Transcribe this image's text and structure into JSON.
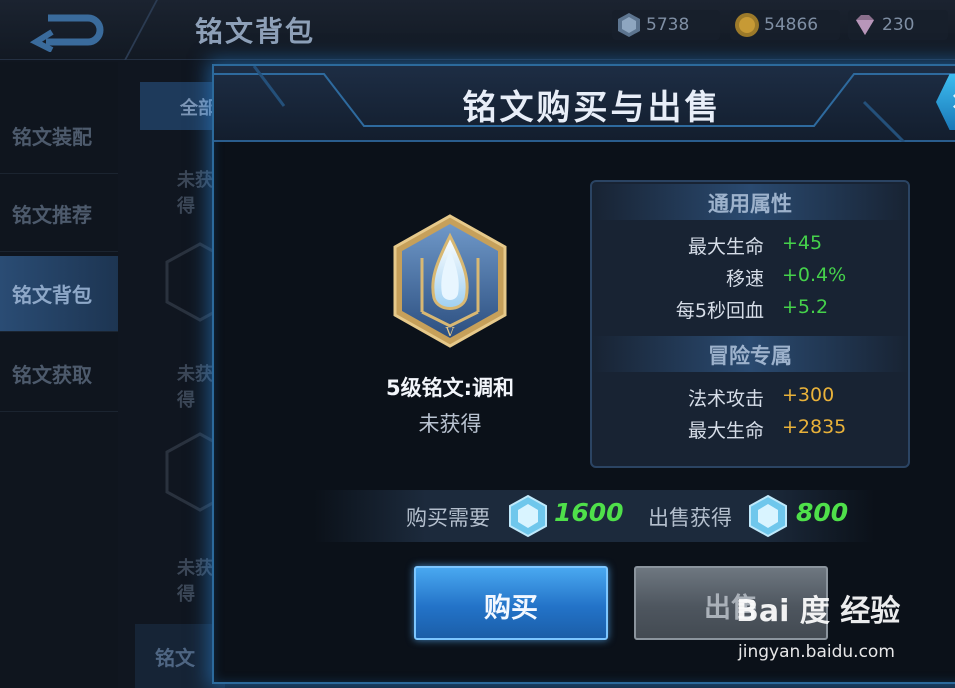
{
  "topbar": {
    "title": "铭文背包",
    "currencies": [
      {
        "name": "crystal",
        "amount": "5738"
      },
      {
        "name": "gold",
        "amount": "54866"
      },
      {
        "name": "diamond",
        "amount": "230"
      }
    ]
  },
  "sidebar": {
    "items": [
      {
        "label": "铭文装配"
      },
      {
        "label": "铭文推荐"
      },
      {
        "label": "铭文背包"
      },
      {
        "label": "铭文获取"
      }
    ],
    "active": "铭文背包"
  },
  "background_list": {
    "tab_label": "全部",
    "cells": [
      "未获得",
      "未获得",
      "未获得"
    ],
    "footer_label": "铭文"
  },
  "dialog": {
    "title": "铭文购买与出售",
    "rune": {
      "name": "5级铭文:调和",
      "status": "未获得",
      "icon": "teardrop-hexagon-rune-icon"
    },
    "general_stats": {
      "heading": "通用属性",
      "rows": [
        {
          "label": "最大生命",
          "value": "+45"
        },
        {
          "label": "移速",
          "value": "+0.4%"
        },
        {
          "label": "每5秒回血",
          "value": "+5.2"
        }
      ]
    },
    "adventure_stats": {
      "heading": "冒险专属",
      "rows": [
        {
          "label": "法术攻击",
          "value": "+300"
        },
        {
          "label": "最大生命",
          "value": "+2835"
        }
      ]
    },
    "buy_price": {
      "label": "购买需要",
      "amount": "1600"
    },
    "sell_price": {
      "label": "出售获得",
      "amount": "800"
    },
    "buy_button": "购买",
    "sell_button": "出售"
  },
  "watermark": {
    "logo_text": "Bai 度 经验",
    "url": "jingyan.baidu.com"
  },
  "colors": {
    "stat_green": "#45d24b",
    "stat_gold": "#e9b23a",
    "accent_blue": "#2f8fe0"
  }
}
